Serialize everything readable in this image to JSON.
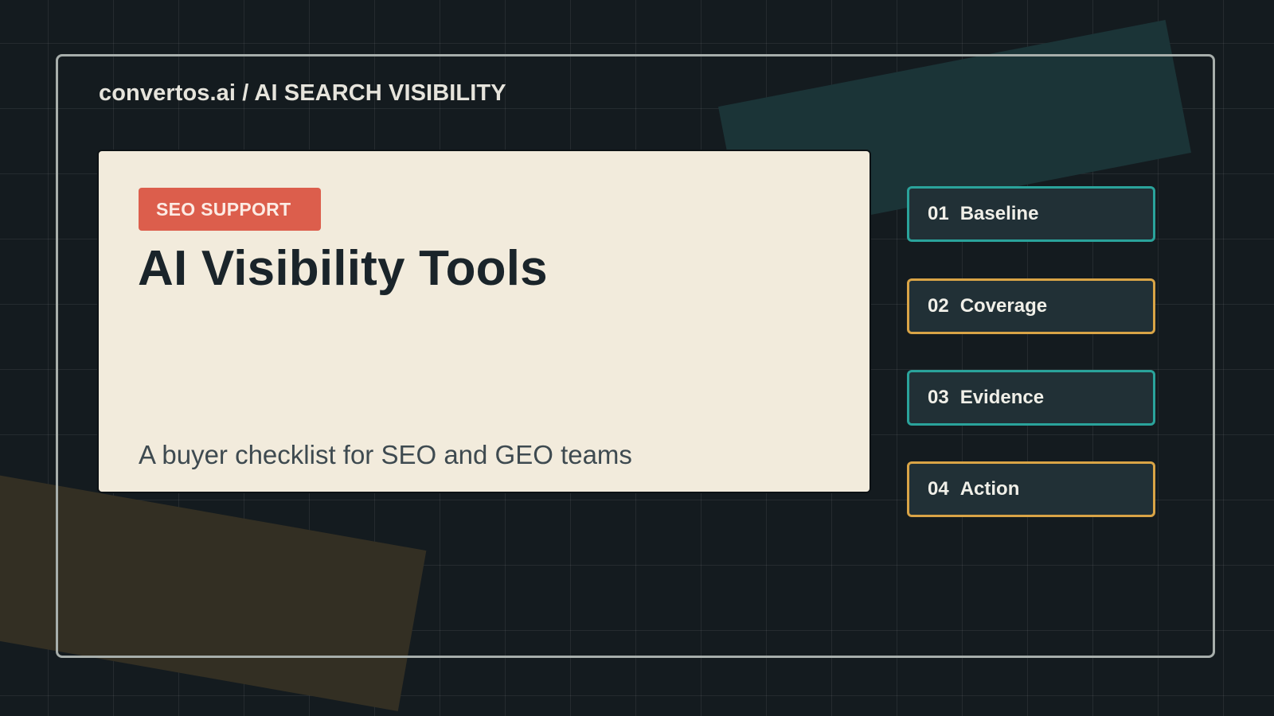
{
  "header": {
    "brand": "convertos.ai / AI SEARCH VISIBILITY"
  },
  "card": {
    "badge": "SEO SUPPORT",
    "title": "AI Visibility Tools",
    "subtitle": "A buyer checklist for SEO and GEO teams"
  },
  "steps": [
    {
      "number": "01",
      "label": "Baseline",
      "accent": "#2aa39b"
    },
    {
      "number": "02",
      "label": "Coverage",
      "accent": "#d9a446"
    },
    {
      "number": "03",
      "label": "Evidence",
      "accent": "#2aa39b"
    },
    {
      "number": "04",
      "label": "Action",
      "accent": "#d9a446"
    }
  ],
  "colors": {
    "background": "#141b1f",
    "card": "#f2ebdc",
    "badge": "#dc5e4c",
    "teal": "#2aa39b",
    "amber": "#d9a446"
  }
}
